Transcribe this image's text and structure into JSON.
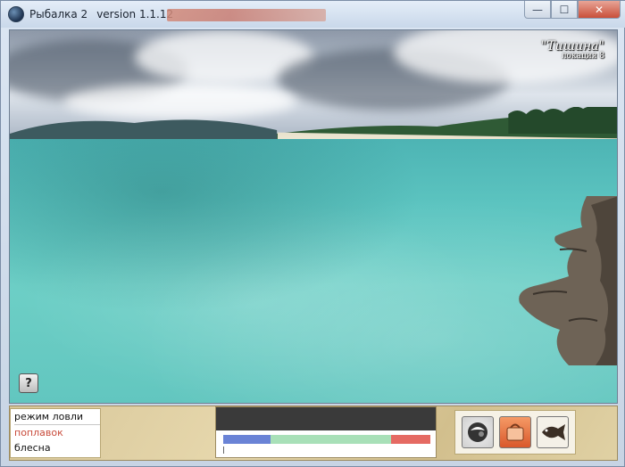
{
  "window": {
    "title": "Рыбалка 2",
    "version": "version 1.1.12",
    "controls": {
      "minimize": "—",
      "maximize": "☐",
      "close": "✕"
    }
  },
  "scene": {
    "location_title": "\"Тишина\"",
    "location_subtitle": "локация 8",
    "help_icon": "help-icon",
    "help_label": "?"
  },
  "panel": {
    "modes": {
      "header": "режим ловли",
      "float": "поплавок",
      "spoon": "блесна",
      "active_color": "#c84a3a"
    },
    "tension": {
      "segments": [
        {
          "name": "blue",
          "color": "#6a83d6",
          "fraction": 0.23
        },
        {
          "name": "green",
          "color": "#a8e0b8",
          "fraction": 0.58
        },
        {
          "name": "red",
          "color": "#e56a63",
          "fraction": 0.19
        }
      ]
    },
    "tools": [
      {
        "name": "bait-tool",
        "icon": "bait-icon"
      },
      {
        "name": "bag-tool",
        "icon": "bag-icon"
      },
      {
        "name": "fish-tool",
        "icon": "fish-icon"
      }
    ]
  }
}
